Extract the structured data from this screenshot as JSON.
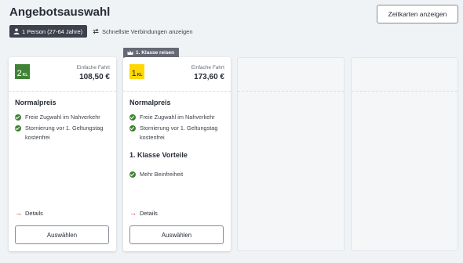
{
  "page": {
    "title": "Angebotsauswahl"
  },
  "header": {
    "zeitkarten_label": "Zeitkarten anzeigen",
    "traveler_chip": "1 Person (27-64 Jahre)",
    "fast_connections_label": "Schnellste Verbindungen anzeigen"
  },
  "badge": {
    "label": "1. Klasse reisen",
    "icon": "crown-icon"
  },
  "offers": [
    {
      "class_num": "2",
      "class_suffix": "KL",
      "class_color": "#408335",
      "fare_label": "Einfache Fahrt",
      "price": "108,50 €",
      "tariff": "Normalpreis",
      "benefits": [
        "Freie Zugwahl im Nahverkehr",
        "Stornierung vor 1. Geltungstag kostenfrei"
      ],
      "details_label": "Details",
      "select_label": "Auswählen"
    },
    {
      "class_num": "1",
      "class_suffix": "KL",
      "class_color": "#ffd800",
      "fare_label": "Einfache Fahrt",
      "price": "173,60 €",
      "tariff": "Normalpreis",
      "benefits": [
        "Freie Zugwahl im Nahverkehr",
        "Stornierung vor 1. Geltungstag kostenfrei"
      ],
      "extra_section_title": "1. Klasse Vorteile",
      "extra_benefits": [
        "Mehr Beinfreiheit"
      ],
      "details_label": "Details",
      "select_label": "Auswählen"
    }
  ],
  "colors": {
    "accent_red": "#ec0016",
    "check_green": "#408335",
    "background": "#f0f3f5"
  }
}
